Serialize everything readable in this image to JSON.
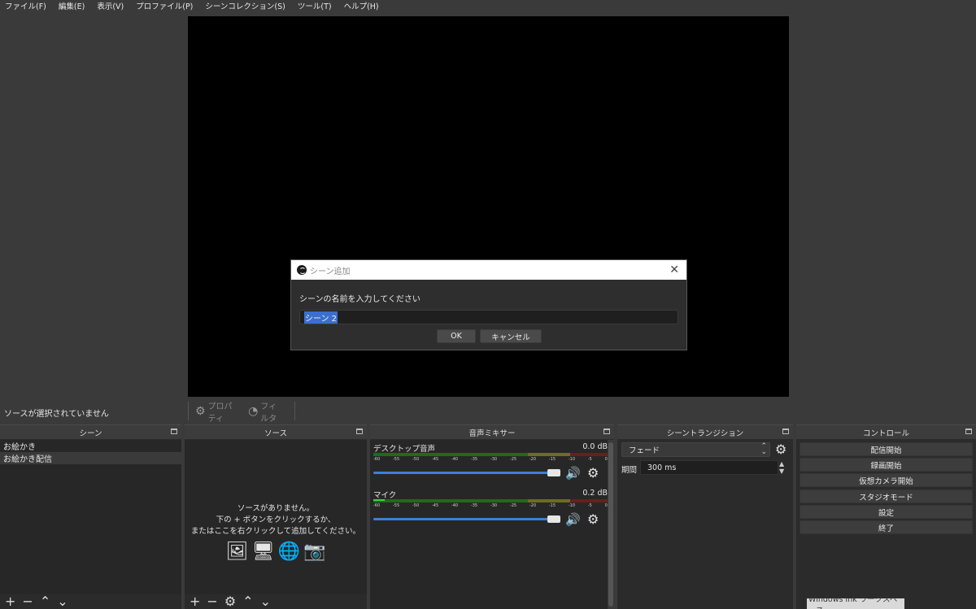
{
  "menu": [
    "ファイル(F)",
    "編集(E)",
    "表示(V)",
    "プロファイル(P)",
    "シーンコレクション(S)",
    "ツール(T)",
    "ヘルプ(H)"
  ],
  "dialog": {
    "title": "シーン追加",
    "close": "✕",
    "prompt": "シーンの名前を入力してください",
    "value": "シーン 2",
    "ok": "OK",
    "cancel": "キャンセル"
  },
  "status": {
    "no_source": "ソースが選択されていません",
    "properties": "プロパティ",
    "filters": "フィルタ",
    "properties_icon": "gear-icon",
    "filters_icon": "filter-icon"
  },
  "scenes": {
    "header": "シーン",
    "items": [
      "お絵かき",
      "お絵かき配信"
    ],
    "selected_index": 1
  },
  "sources": {
    "header": "ソース",
    "empty_line1": "ソースがありません。",
    "empty_line2": "下の + ボタンをクリックするか、",
    "empty_line3": "またはここを右クリックして追加してください。",
    "icons": [
      "image-icon",
      "monitor-icon",
      "globe-icon",
      "camera-icon"
    ]
  },
  "mixer": {
    "header": "音声ミキサー",
    "ticks": [
      "-60",
      "-55",
      "-50",
      "-45",
      "-40",
      "-35",
      "-30",
      "-25",
      "-20",
      "-15",
      "-10",
      "-5",
      "0"
    ],
    "tracks": [
      {
        "name": "デスクトップ音声",
        "db": "0.0 dB",
        "level": 0.0
      },
      {
        "name": "マイク",
        "db": "0.2 dB",
        "level": 0.05
      }
    ]
  },
  "transitions": {
    "header": "シーントランジション",
    "selected": "フェード",
    "duration_label": "期間",
    "duration_value": "300 ms"
  },
  "controls": {
    "header": "コントロール",
    "buttons": [
      "配信開始",
      "録画開始",
      "仮想カメラ開始",
      "スタジオモード",
      "設定",
      "終了"
    ]
  },
  "taskbar": {
    "ink": "Windows Ink ワークスペース"
  },
  "colors": {
    "accent": "#3d7fd9",
    "selection": "#3a6fd0",
    "meter_green": "#42d042"
  }
}
